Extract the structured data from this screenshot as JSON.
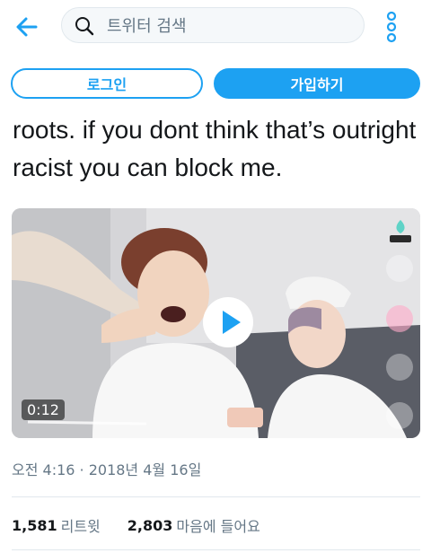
{
  "header": {
    "search_placeholder": "트위터 검색",
    "icons": {
      "back": "arrow-left-icon",
      "search": "search-icon",
      "more": "vertical-dots-icon"
    }
  },
  "auth": {
    "login_label": "로그인",
    "signup_label": "가입하기"
  },
  "tweet": {
    "text_lines": [
      "roots. if you dont think that’s outright",
      "racist you can block me."
    ],
    "media": {
      "duration": "0:12",
      "icons": [
        "play-icon",
        "vlive-logo",
        "vlive-more-icon",
        "vlive-heart-icon",
        "vlive-camera-icon",
        "vlive-expand-icon"
      ]
    },
    "timestamp": "오전 4:16 · 2018년 4월 16일",
    "stats": {
      "retweets_count": "1,581",
      "retweets_label": "리트윗",
      "likes_count": "2,803",
      "likes_label": "마음에 들어요"
    }
  },
  "colors": {
    "accent": "#1da1f2",
    "text": "#14171a",
    "secondary_text": "#657786",
    "border": "#e1e8ed"
  }
}
